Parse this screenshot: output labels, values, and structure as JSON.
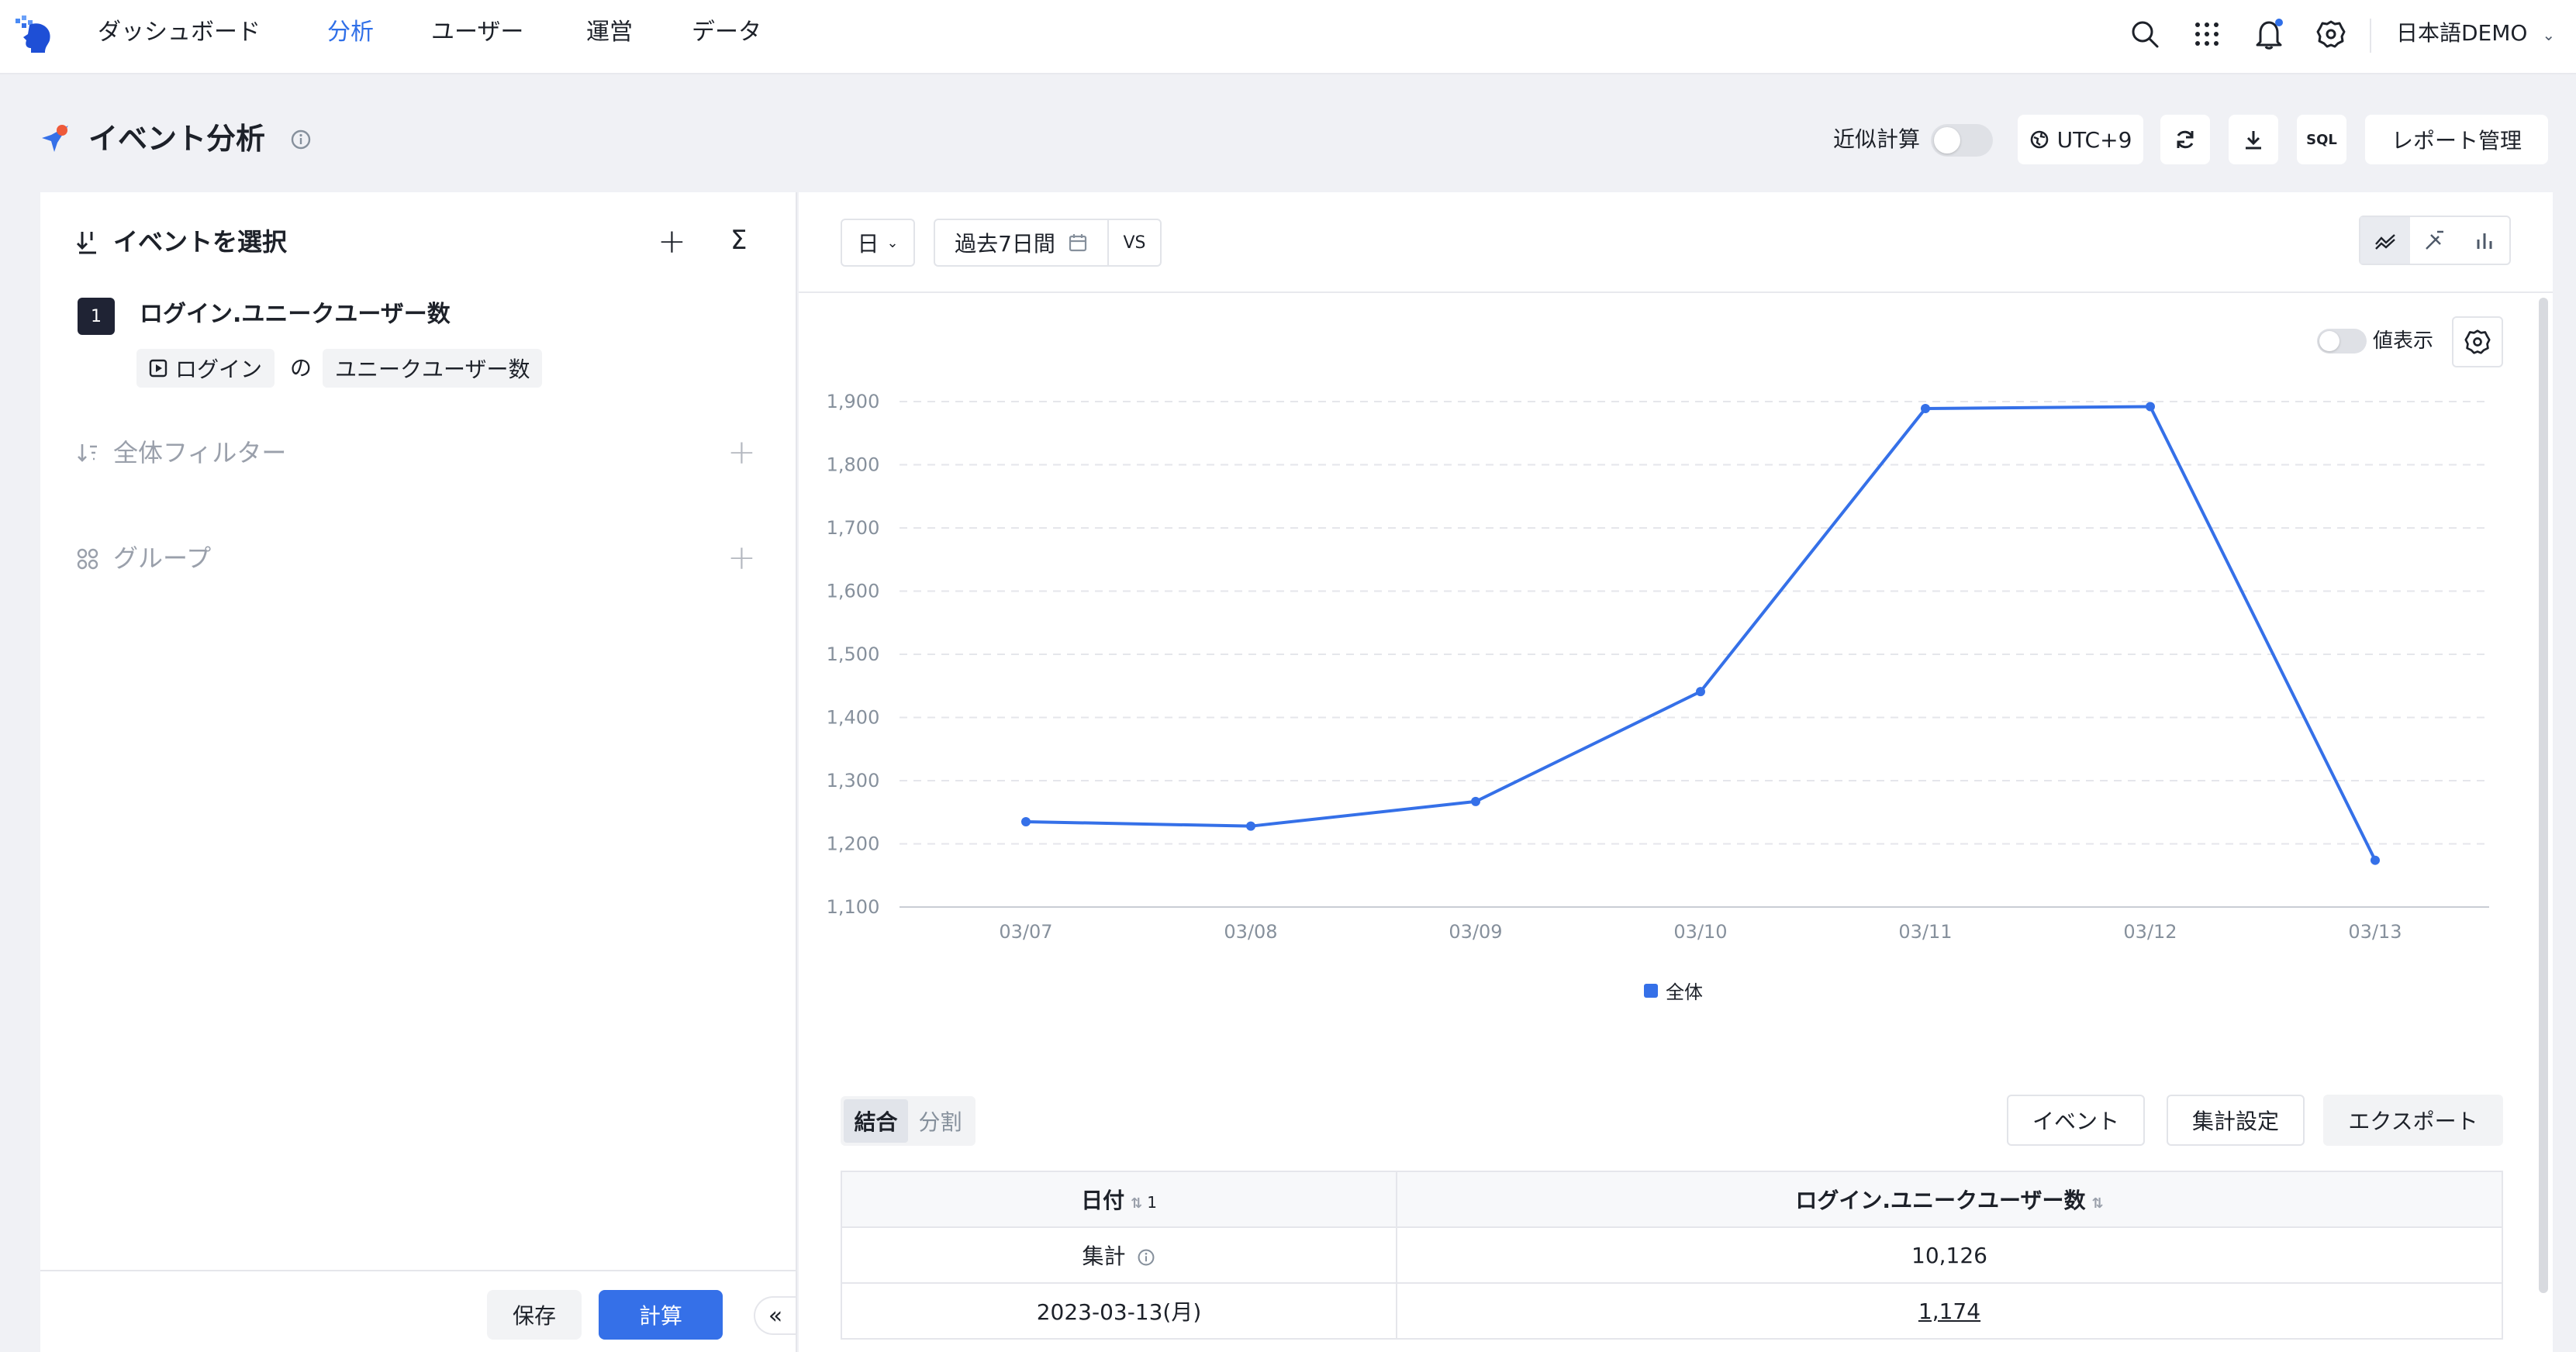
{
  "nav": {
    "items": [
      {
        "label": "ダッシュボード",
        "active": false
      },
      {
        "label": "分析",
        "active": true
      },
      {
        "label": "ユーザー",
        "active": false
      },
      {
        "label": "運営",
        "active": false
      },
      {
        "label": "データ",
        "active": false
      }
    ],
    "language": "日本語DEMO",
    "accent": "#2f6fe8"
  },
  "header": {
    "title": "イベント分析",
    "approx_label": "近似計算",
    "approx_on": false,
    "timezone": "UTC+9",
    "sql_label": "SQL",
    "report_label": "レポート管理"
  },
  "left": {
    "event_section": "イベントを選択",
    "events": [
      {
        "index": "1",
        "name": "ログイン.ユニークユーザー数",
        "event_chip": "ログイン",
        "connector": "の",
        "metric_chip": "ユニークユーザー数"
      }
    ],
    "filter_section": "全体フィルター",
    "group_section": "グループ",
    "save_label": "保存",
    "calc_label": "計算"
  },
  "toolbar": {
    "granularity": "日",
    "date_range": "過去7日間",
    "vs_label": "VS",
    "value_display_label": "値表示"
  },
  "chart_data": {
    "type": "line",
    "categories": [
      "03/07",
      "03/08",
      "03/09",
      "03/10",
      "03/11",
      "03/12",
      "03/13"
    ],
    "series": [
      {
        "name": "全体",
        "color": "#3570e8",
        "values": [
          1235,
          1228,
          1267,
          1441,
          1889,
          1892,
          1174
        ]
      }
    ],
    "ylim": [
      1100,
      1900
    ],
    "yticks": [
      "1,100",
      "1,200",
      "1,300",
      "1,400",
      "1,500",
      "1,600",
      "1,700",
      "1,800",
      "1,900"
    ],
    "grid": true,
    "legend": "bottom-center"
  },
  "table_controls": {
    "tabs": [
      "結合",
      "分割"
    ],
    "buttons": [
      "イベント",
      "集計設定",
      "エクスポート"
    ]
  },
  "table": {
    "columns": [
      "日付",
      "ログイン.ユニークユーザー数"
    ],
    "sort_index": "1",
    "rows": [
      {
        "date": "集計",
        "value": "10,126"
      },
      {
        "date": "2023-03-13(月)",
        "value": "1,174"
      }
    ]
  }
}
